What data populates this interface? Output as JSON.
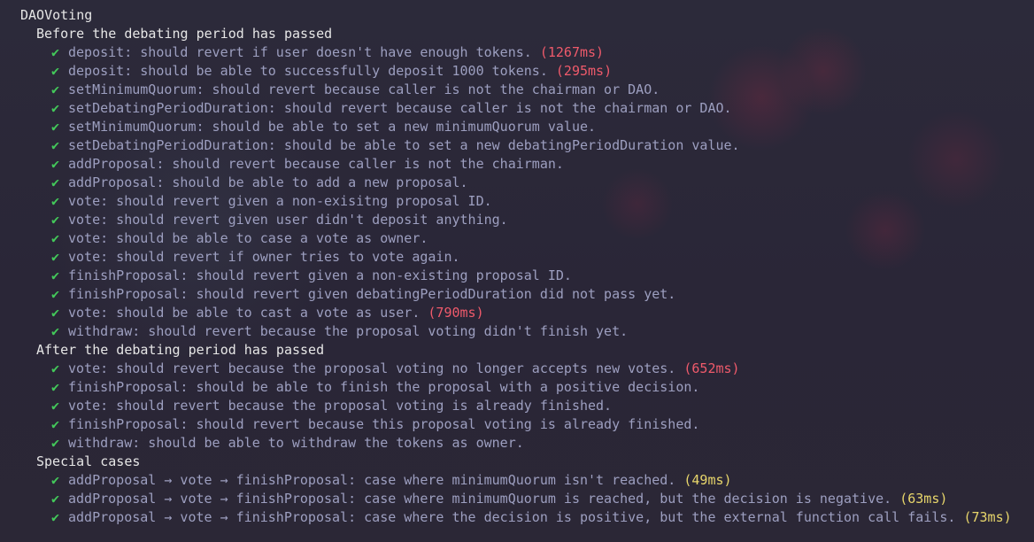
{
  "suite": "DAOVoting",
  "colors": {
    "pass_check": "#43c95a",
    "test_text": "#9d9fc0",
    "slow_duration": "#ef5a6b",
    "medium_duration": "#e8d66b",
    "heading": "#e6e6e6",
    "background": "#2a2738"
  },
  "icon": "check-mark-icon",
  "check_glyph": "✔",
  "groups": [
    {
      "title": "Before the debating period has passed",
      "tests": [
        {
          "name": "deposit: should revert if user doesn't have enough tokens.",
          "duration": "(1267ms)",
          "speed": "slow"
        },
        {
          "name": "deposit: should be able to successfully deposit 1000 tokens.",
          "duration": "(295ms)",
          "speed": "slow"
        },
        {
          "name": "setMinimumQuorum: should revert because caller is not the chairman or DAO.",
          "duration": "",
          "speed": ""
        },
        {
          "name": "setDebatingPeriodDuration: should revert because caller is not the chairman or DAO.",
          "duration": "",
          "speed": ""
        },
        {
          "name": "setMinimumQuorum: should be able to set a new minimumQuorum value.",
          "duration": "",
          "speed": ""
        },
        {
          "name": "setDebatingPeriodDuration: should be able to set a new debatingPeriodDuration value.",
          "duration": "",
          "speed": ""
        },
        {
          "name": "addProposal: should revert because caller is not the chairman.",
          "duration": "",
          "speed": ""
        },
        {
          "name": "addProposal: should be able to add a new proposal.",
          "duration": "",
          "speed": ""
        },
        {
          "name": "vote: should revert given a non-exisitng proposal ID.",
          "duration": "",
          "speed": ""
        },
        {
          "name": "vote: should revert given user didn't deposit anything.",
          "duration": "",
          "speed": ""
        },
        {
          "name": "vote: should be able to case a vote as owner.",
          "duration": "",
          "speed": ""
        },
        {
          "name": "vote: should revert if owner tries to vote again.",
          "duration": "",
          "speed": ""
        },
        {
          "name": "finishProposal: should revert given a non-existing proposal ID.",
          "duration": "",
          "speed": ""
        },
        {
          "name": "finishProposal: should revert given debatingPeriodDuration did not pass yet.",
          "duration": "",
          "speed": ""
        },
        {
          "name": "vote: should be able to cast a vote as user.",
          "duration": "(790ms)",
          "speed": "slow"
        },
        {
          "name": "withdraw: should revert because the proposal voting didn't finish yet.",
          "duration": "",
          "speed": ""
        }
      ]
    },
    {
      "title": "After the debating period has passed",
      "tests": [
        {
          "name": "vote: should revert because the proposal voting no longer accepts new votes.",
          "duration": "(652ms)",
          "speed": "slow"
        },
        {
          "name": "finishProposal: should be able to finish the proposal with a positive decision.",
          "duration": "",
          "speed": ""
        },
        {
          "name": "vote: should revert because the proposal voting is already finished.",
          "duration": "",
          "speed": ""
        },
        {
          "name": "finishProposal: should revert because this proposal voting is already finished.",
          "duration": "",
          "speed": ""
        },
        {
          "name": "withdraw: should be able to withdraw the tokens as owner.",
          "duration": "",
          "speed": ""
        }
      ]
    },
    {
      "title": "Special cases",
      "tests": [
        {
          "name": "addProposal → vote → finishProposal: case where minimumQuorum isn't reached.",
          "duration": "(49ms)",
          "speed": "medium"
        },
        {
          "name": "addProposal → vote → finishProposal: case where minimumQuorum is reached, but the decision is negative.",
          "duration": "(63ms)",
          "speed": "medium"
        },
        {
          "name": "addProposal → vote → finishProposal: case where the decision is positive, but the external function call fails.",
          "duration": "(73ms)",
          "speed": "medium"
        }
      ]
    }
  ]
}
